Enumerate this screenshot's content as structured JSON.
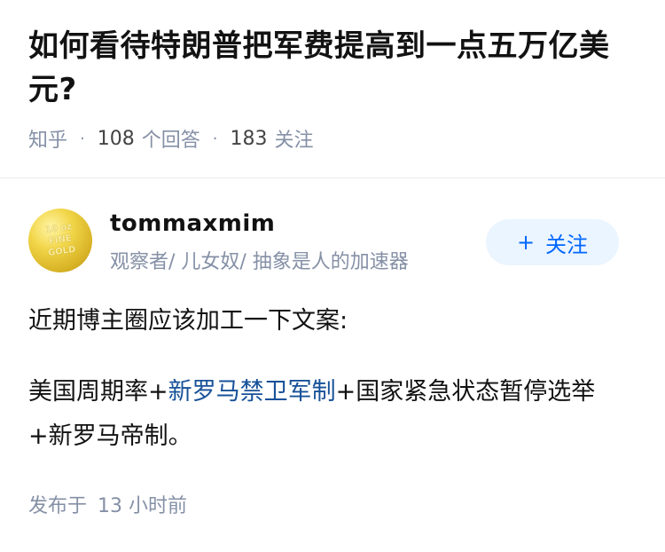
{
  "question": {
    "title": "如何看待特朗普把军费提高到一点五万亿美元?",
    "source": "知乎",
    "answer_count": "108",
    "answer_label": "个回答",
    "follower_count": "183",
    "follower_label": "关注"
  },
  "author": {
    "name": "tommaxmim",
    "bio": "观察者/ 儿女奴/ 抽象是人的加速器",
    "avatar_text": [
      "10 oz",
      "FINE",
      "GOLD"
    ],
    "follow_label": "关注",
    "follow_icon": "plus-icon"
  },
  "answer": {
    "paragraph1": "近期博主圈应该加工一下文案:",
    "paragraph2_part1": "美国周期率+",
    "paragraph2_link": "新罗马禁卫军制",
    "paragraph2_part2": "+国家紧急状态暂停选举+新罗马帝制。"
  },
  "footer": {
    "published_label": "发布于",
    "published_time": "13 小时前"
  },
  "colors": {
    "link": "#175199",
    "meta": "#8590a6",
    "follow_bg": "#ebf5ff",
    "follow_text": "#0066ff"
  }
}
